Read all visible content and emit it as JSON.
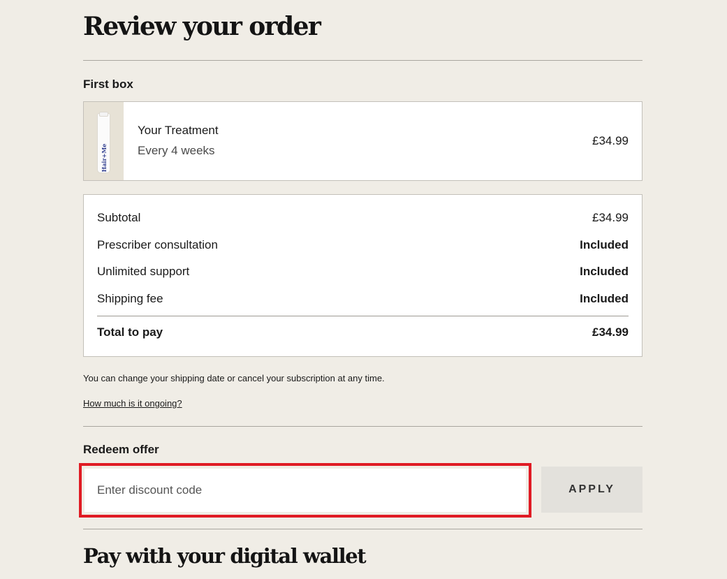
{
  "review": {
    "title": "Review your order"
  },
  "first_box": {
    "label": "First box",
    "item": {
      "brand": "Hair+Me",
      "name": "Your Treatment",
      "frequency": "Every 4 weeks",
      "price": "£34.99"
    }
  },
  "summary": {
    "rows": [
      {
        "label": "Subtotal",
        "value": "£34.99"
      },
      {
        "label": "Prescriber consultation",
        "value": "Included"
      },
      {
        "label": "Unlimited support",
        "value": "Included"
      },
      {
        "label": "Shipping fee",
        "value": "Included"
      }
    ],
    "total": {
      "label": "Total to pay",
      "value": "£34.99"
    }
  },
  "note": "You can change your shipping date or cancel your subscription at any time.",
  "ongoing_link": "How much is it ongoing?",
  "redeem": {
    "label": "Redeem offer",
    "placeholder": "Enter discount code",
    "value": "",
    "apply_label": "APPLY",
    "highlight_color": "#e01b24"
  },
  "wallet": {
    "title": "Pay with your digital wallet"
  }
}
